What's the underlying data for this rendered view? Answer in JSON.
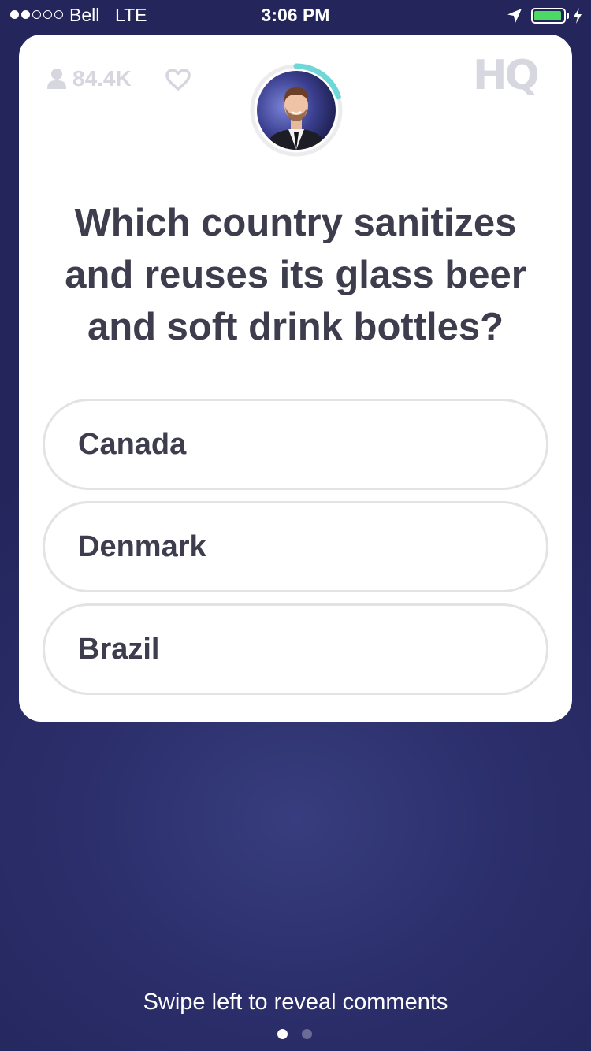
{
  "status_bar": {
    "carrier": "Bell",
    "network": "LTE",
    "time": "3:06 PM",
    "signal_bars_filled": 2,
    "signal_bars_total": 5,
    "battery_level": 0.95,
    "battery_color": "#4cd964"
  },
  "header": {
    "viewer_count": "84.4K",
    "viewer_icon": "person-icon",
    "like_icon": "heart-icon",
    "logo": "HQ",
    "host_timer_progress": 0.2,
    "timer_color": "#6fd7d8"
  },
  "question": {
    "text": "Which country sanitizes and reuses its glass beer and soft drink bottles?"
  },
  "answers": [
    {
      "label": "Canada"
    },
    {
      "label": "Denmark"
    },
    {
      "label": "Brazil"
    }
  ],
  "footer": {
    "hint": "Swipe left to reveal comments",
    "pages": 2,
    "active_page": 1
  },
  "colors": {
    "background": "#2b2e6a",
    "question_text": "#3d3d4e",
    "muted": "#d5d6de"
  }
}
